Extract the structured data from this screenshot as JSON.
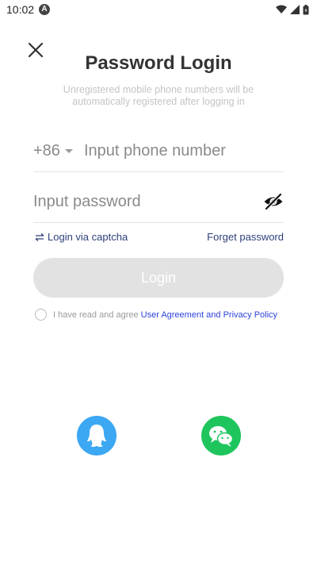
{
  "status_bar": {
    "time": "10:02",
    "app_icon_letter": "A"
  },
  "header": {
    "close_icon": "close-icon",
    "title": "Password Login",
    "subtitle_line1": "Unregistered mobile phone numbers will be",
    "subtitle_line2": "automatically registered after logging in"
  },
  "form": {
    "country_code": "+86",
    "phone": {
      "value": "",
      "placeholder": "Input phone number"
    },
    "password": {
      "value": "",
      "placeholder": "Input password"
    },
    "captcha_link": "Login via captcha",
    "forget_link": "Forget password",
    "login_label": "Login",
    "agree_text": "I have read and agree",
    "agree_link": "User Agreement and Privacy Policy"
  },
  "social": {
    "qq_icon": "qq-icon",
    "wechat_icon": "wechat-icon"
  },
  "colors": {
    "login_button_disabled": "#e2e2e2",
    "link": "#2d3f7a",
    "agreement_link": "#2c43d8",
    "qq": "#3ca7f2",
    "wechat": "#1ec55d"
  }
}
